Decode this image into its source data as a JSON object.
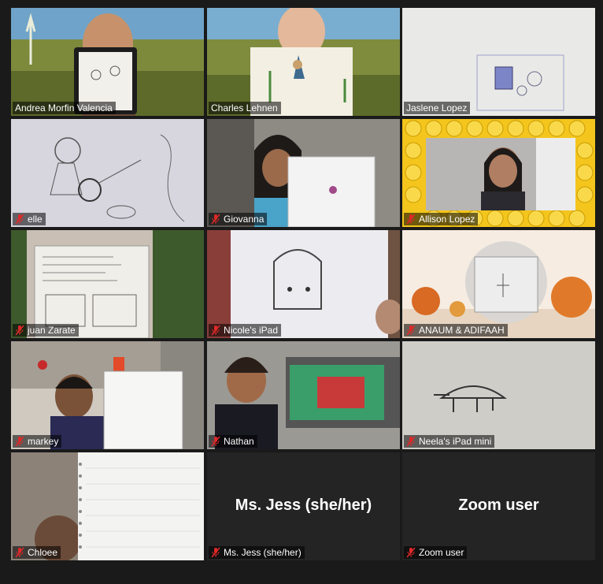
{
  "participants": [
    {
      "name": "Andrea Morfin Valencia",
      "muted": false,
      "active": true
    },
    {
      "name": "Charles Lehnen",
      "muted": false,
      "active": false
    },
    {
      "name": "Jaslene Lopez",
      "muted": false,
      "active": false
    },
    {
      "name": "elle",
      "muted": true,
      "active": false
    },
    {
      "name": "Giovanna",
      "muted": true,
      "active": false
    },
    {
      "name": "Allison Lopez",
      "muted": true,
      "active": false
    },
    {
      "name": "juan Zarate",
      "muted": true,
      "active": false
    },
    {
      "name": "Nicole's iPad",
      "muted": true,
      "active": false
    },
    {
      "name": "ANAUM & ADIFAAH",
      "muted": true,
      "active": false
    },
    {
      "name": "markey",
      "muted": true,
      "active": false
    },
    {
      "name": "Nathan",
      "muted": true,
      "active": false
    },
    {
      "name": "Neela's iPad mini",
      "muted": true,
      "active": false
    },
    {
      "name": "Chloee",
      "muted": true,
      "active": false
    },
    {
      "name": "Ms. Jess (she/her)",
      "muted": true,
      "active": false,
      "video_off_name": "Ms. Jess (she/her)"
    },
    {
      "name": "Zoom user",
      "muted": true,
      "active": false,
      "video_off_name": "Zoom user"
    }
  ],
  "colors": {
    "active_border": "#d7e66a",
    "muted_icon": "#e02828",
    "background": "#1a1a1a"
  }
}
